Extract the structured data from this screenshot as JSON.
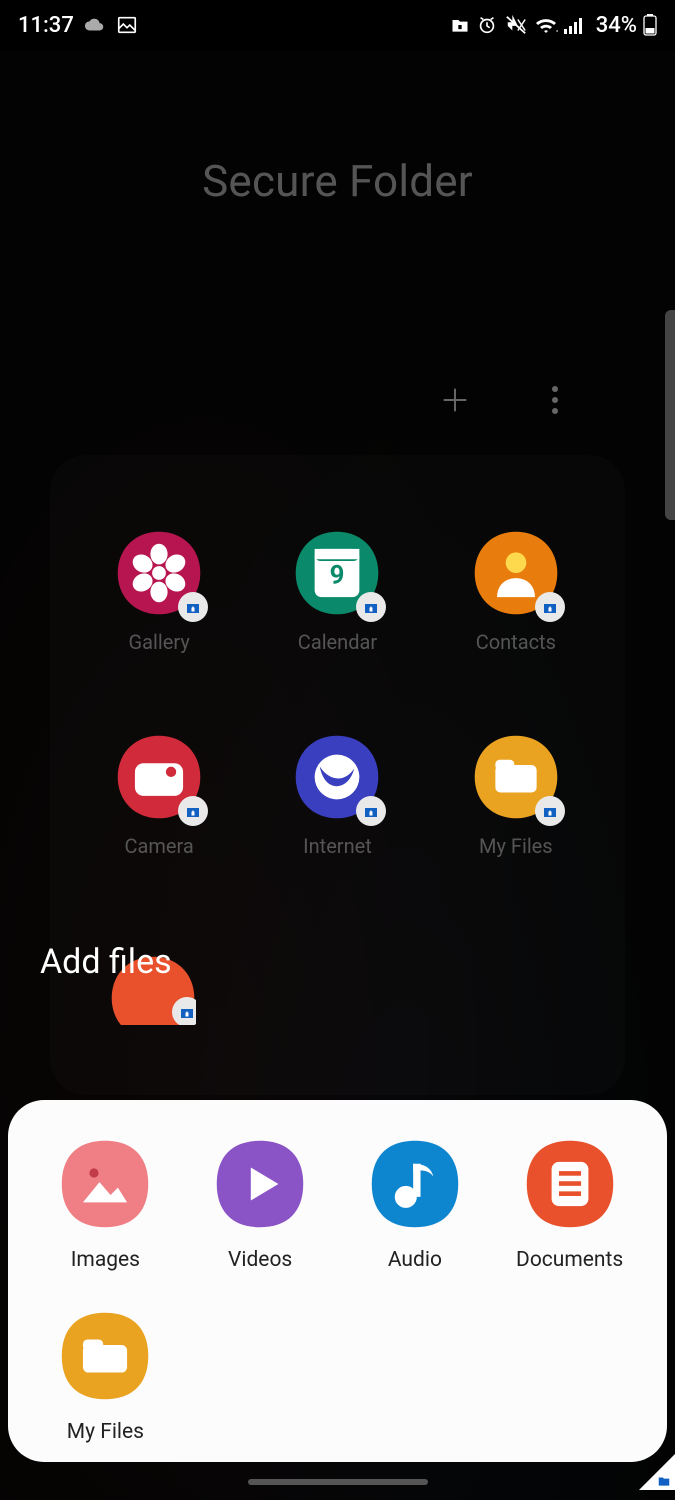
{
  "status": {
    "time": "11:37",
    "battery_pct": "34%"
  },
  "bg": {
    "title": "Secure Folder",
    "apps": [
      {
        "label": "Gallery"
      },
      {
        "label": "Calendar"
      },
      {
        "label": "Contacts"
      },
      {
        "label": "Camera"
      },
      {
        "label": "Internet"
      },
      {
        "label": "My Files"
      }
    ]
  },
  "sheet": {
    "title": "Add files",
    "items": [
      {
        "label": "Images",
        "color": "#ef7f85",
        "icon": "image"
      },
      {
        "label": "Videos",
        "color": "#8a53c6",
        "icon": "play"
      },
      {
        "label": "Audio",
        "color": "#0d86cf",
        "icon": "note"
      },
      {
        "label": "Documents",
        "color": "#e8512b",
        "icon": "doc"
      },
      {
        "label": "My Files",
        "color": "#eaa321",
        "icon": "folder"
      }
    ]
  }
}
